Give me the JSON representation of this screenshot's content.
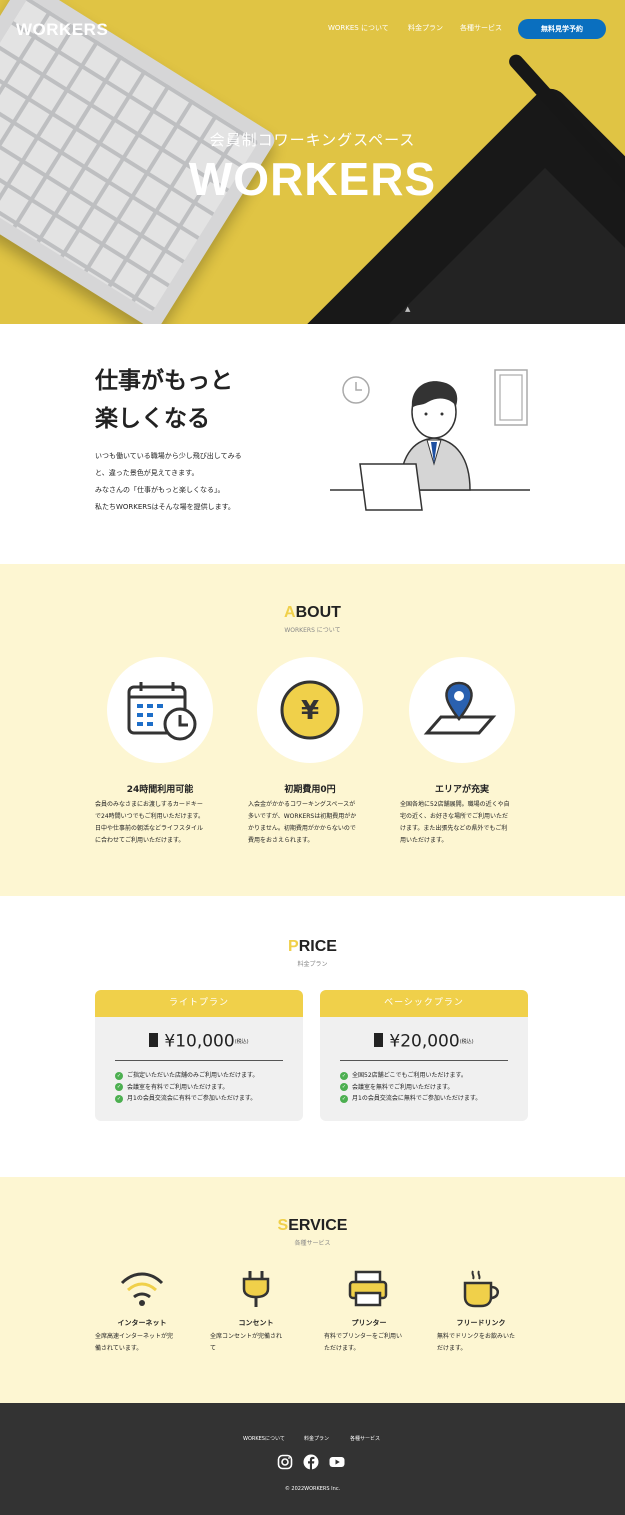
{
  "header": {
    "logo": "WORKERS",
    "nav": [
      "WORKES について",
      "料金プラン",
      "各種サービス"
    ],
    "cta": "無料見学予約"
  },
  "hero": {
    "subtitle": "会員制コワーキングスペース",
    "title": "WORKERS",
    "scroll_icon": "chevron-up-icon"
  },
  "intro": {
    "title_line1": "仕事がもっと",
    "title_line2": "楽しくなる",
    "body": [
      "いつも働いている職場から少し飛び出してみる",
      "と、違った景色が見えてきます。",
      "みなさんの「仕事がもっと楽しくなる」。",
      "私たちWORKERSはそんな場を提供します。"
    ]
  },
  "about": {
    "title_first": "A",
    "title_rest": "BOUT",
    "subtitle": "WORKERS について",
    "features": [
      {
        "icon": "calendar-clock-icon",
        "title": "24時間利用可能",
        "body": [
          "会員のみなさまにお渡しするカードキー",
          "で24時間いつでもご利用いただけます。",
          "日中や仕事前の朝活などライフスタイル",
          "に合わせてご利用いただけます。"
        ]
      },
      {
        "icon": "yen-coin-icon",
        "title": "初期費用0円",
        "body": [
          "入会金がかかるコワーキングスペースが",
          "多いですが、WORKERSは初期費用がか",
          "かりません。初期費用がかからないので",
          "費用をおさえられます。"
        ]
      },
      {
        "icon": "map-pin-icon",
        "title": "エリアが充実",
        "body": [
          "全国各地に52店舗展開。職場の近くや自",
          "宅の近く、お好きな場所でご利用いただ",
          "けます。また出張先などの県外でもご利",
          "用いただけます。"
        ]
      }
    ]
  },
  "price": {
    "title_first": "P",
    "title_rest": "RICE",
    "subtitle": "料金プラン",
    "tax_label": "(税込)",
    "plans": [
      {
        "name": "ライトプラン",
        "price": "¥10,000",
        "items": [
          "ご指定いただいた店舗のみご利用いただけます。",
          "会議室を有料でご利用いただけます。",
          "月1の会員交流会に有料でご参加いただけます。"
        ]
      },
      {
        "name": "ベーシックプラン",
        "price": "¥20,000",
        "items": [
          "全国52店舗どこでもご利用いただけます。",
          "会議室を無料でご利用いただけます。",
          "月1の会員交流会に無料でご参加いただけます。"
        ]
      }
    ]
  },
  "service": {
    "title_first": "S",
    "title_rest": "ERVICE",
    "subtitle": "各種サービス",
    "items": [
      {
        "icon": "wifi-icon",
        "title": "インターネット",
        "body": [
          "全席高速インターネットが完",
          "備されています。"
        ]
      },
      {
        "icon": "plug-icon",
        "title": "コンセント",
        "body": [
          "全席コンセントが完備され",
          "て"
        ]
      },
      {
        "icon": "printer-icon",
        "title": "プリンター",
        "body": [
          "有料でプリンターをご利用い",
          "ただけます。"
        ]
      },
      {
        "icon": "coffee-cup-icon",
        "title": "フリードリンク",
        "body": [
          "無料でドリンクをお飲みいた",
          "だけます。"
        ]
      }
    ]
  },
  "footer": {
    "links": [
      "WORKESについて",
      "料金プラン",
      "各種サービス"
    ],
    "social": [
      "instagram-icon",
      "facebook-icon",
      "youtube-icon"
    ],
    "copyright": "© 2022WORKERS Inc."
  },
  "colors": {
    "accent": "#f0d04a",
    "cta": "#0a6fbf",
    "section_bg": "#fdf6d2",
    "footer_bg": "#333333",
    "check": "#4caf50"
  }
}
